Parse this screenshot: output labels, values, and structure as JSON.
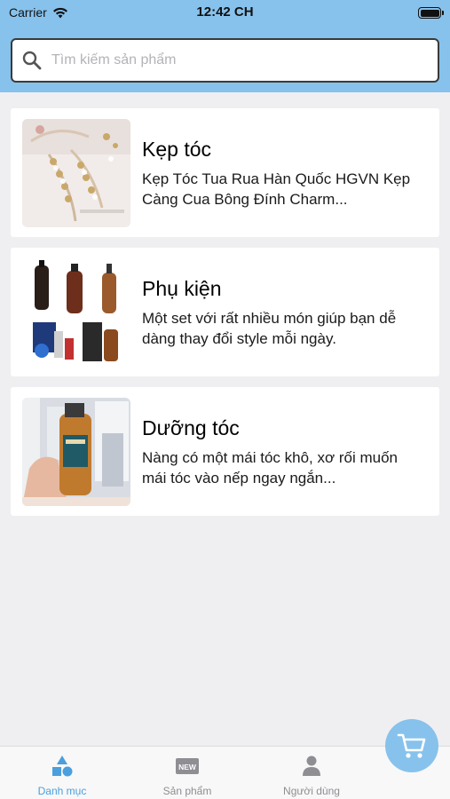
{
  "status_bar": {
    "carrier": "Carrier",
    "time": "12:42 CH",
    "icons": [
      "wifi-icon",
      "battery-icon"
    ]
  },
  "search": {
    "placeholder": "Tìm kiếm sản phẩm",
    "value": ""
  },
  "categories": [
    {
      "title": "Kẹp tóc",
      "description": "Kẹp Tóc Tua Rua Hàn Quốc HGVN Kẹp Càng Cua Bông Đính Charm...",
      "image": "hair-clip-product-photo"
    },
    {
      "title": "Phụ kiện",
      "description": "Một set với rất nhiều món giúp bạn dễ dàng thay đổi style mỗi ngày.",
      "image": "hair-oil-bottles-photo"
    },
    {
      "title": "Dưỡng tóc",
      "description": "Nàng có một mái tóc khô, xơ rối muốn mái tóc vào nếp ngay ngắn...",
      "image": "hair-serum-bottle-photo"
    }
  ],
  "tabbar": {
    "tabs": [
      {
        "label": "Danh mục",
        "icon": "shapes-icon",
        "active": true
      },
      {
        "label": "Sản phẩm",
        "icon": "new-badge-icon",
        "active": false
      },
      {
        "label": "Người dùng",
        "icon": "user-icon",
        "active": false
      }
    ]
  },
  "cart_button": {
    "icon": "cart-icon"
  },
  "colors": {
    "header": "#87c2ec",
    "background": "#efeff1",
    "active_tab": "#4a9fdc",
    "inactive_tab": "#8e8e93"
  }
}
